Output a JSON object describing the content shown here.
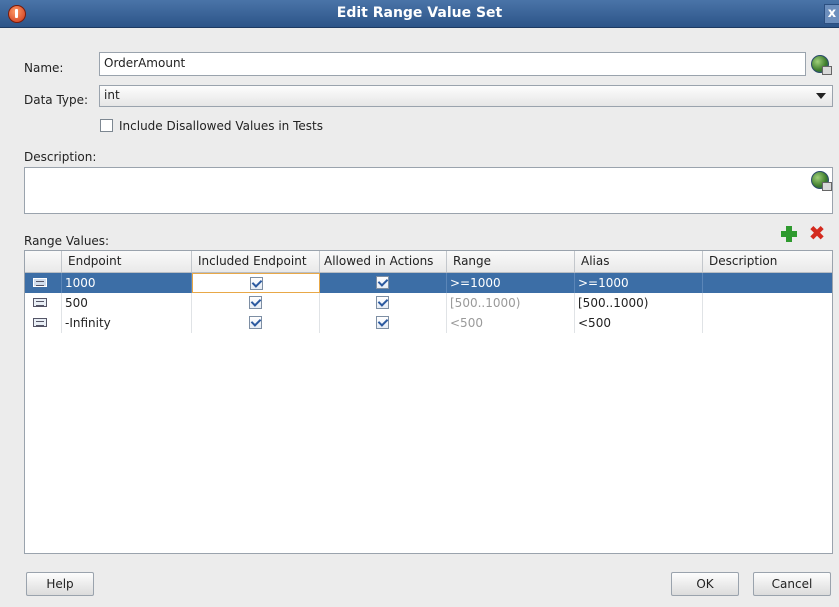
{
  "window": {
    "title": "Edit Range Value Set",
    "close_glyph": "x"
  },
  "name_field": {
    "label": "Name:",
    "value": "OrderAmount"
  },
  "data_type": {
    "label": "Data Type:",
    "value": "int"
  },
  "include_disallowed": {
    "label": "Include Disallowed Values in Tests",
    "checked": false
  },
  "description": {
    "label": "Description:",
    "value": ""
  },
  "range_values": {
    "label": "Range Values:",
    "columns": [
      "Endpoint",
      "Included Endpoint",
      "Allowed in Actions",
      "Range",
      "Alias",
      "Description"
    ],
    "rows": [
      {
        "endpoint": "1000",
        "included": true,
        "allowed": true,
        "range": ">=1000",
        "alias": ">=1000",
        "description": "",
        "selected": true
      },
      {
        "endpoint": "500",
        "included": true,
        "allowed": true,
        "range": "[500..1000)",
        "alias": "[500..1000)",
        "description": "",
        "selected": false
      },
      {
        "endpoint": "-Infinity",
        "included": true,
        "allowed": true,
        "range": "<500",
        "alias": "<500",
        "description": "",
        "selected": false
      }
    ]
  },
  "icons": {
    "add": "add-plus-icon",
    "delete": "delete-x-icon",
    "translate": "translate-globe-icon"
  },
  "buttons": {
    "help": "Help",
    "ok": "OK",
    "cancel": "Cancel"
  },
  "colors": {
    "title_bar": "#3a6498",
    "selection": "#3c6ea6",
    "add": "#2f9a2f",
    "delete": "#d42a1e"
  }
}
